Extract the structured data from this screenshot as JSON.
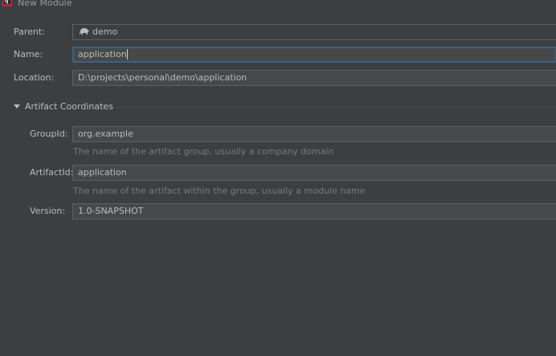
{
  "window": {
    "title": "New Module"
  },
  "form": {
    "parent": {
      "label": "Parent:",
      "value": "demo"
    },
    "name": {
      "label": "Name:",
      "value": "application"
    },
    "location": {
      "label": "Location:",
      "value": "D:\\projects\\personal\\demo\\application"
    }
  },
  "artifact": {
    "section_title": "Artifact Coordinates",
    "group_id": {
      "label": "GroupId:",
      "value": "org.example",
      "hint": "The name of the artifact group, usually a company domain"
    },
    "artifact_id": {
      "label": "ArtifactId:",
      "value": "application",
      "hint": "The name of the artifact within the group, usually a module name"
    },
    "version": {
      "label": "Version:",
      "value": "1.0-SNAPSHOT"
    }
  },
  "icons": {
    "app": "intellij-idea-icon",
    "parent": "gradle-elephant-icon",
    "section": "triangle-down-icon"
  },
  "colors": {
    "background": "#3c3f41",
    "field": "#45494a",
    "focus_border": "#3d6185",
    "text": "#bbbbbb",
    "hint": "#787878"
  }
}
